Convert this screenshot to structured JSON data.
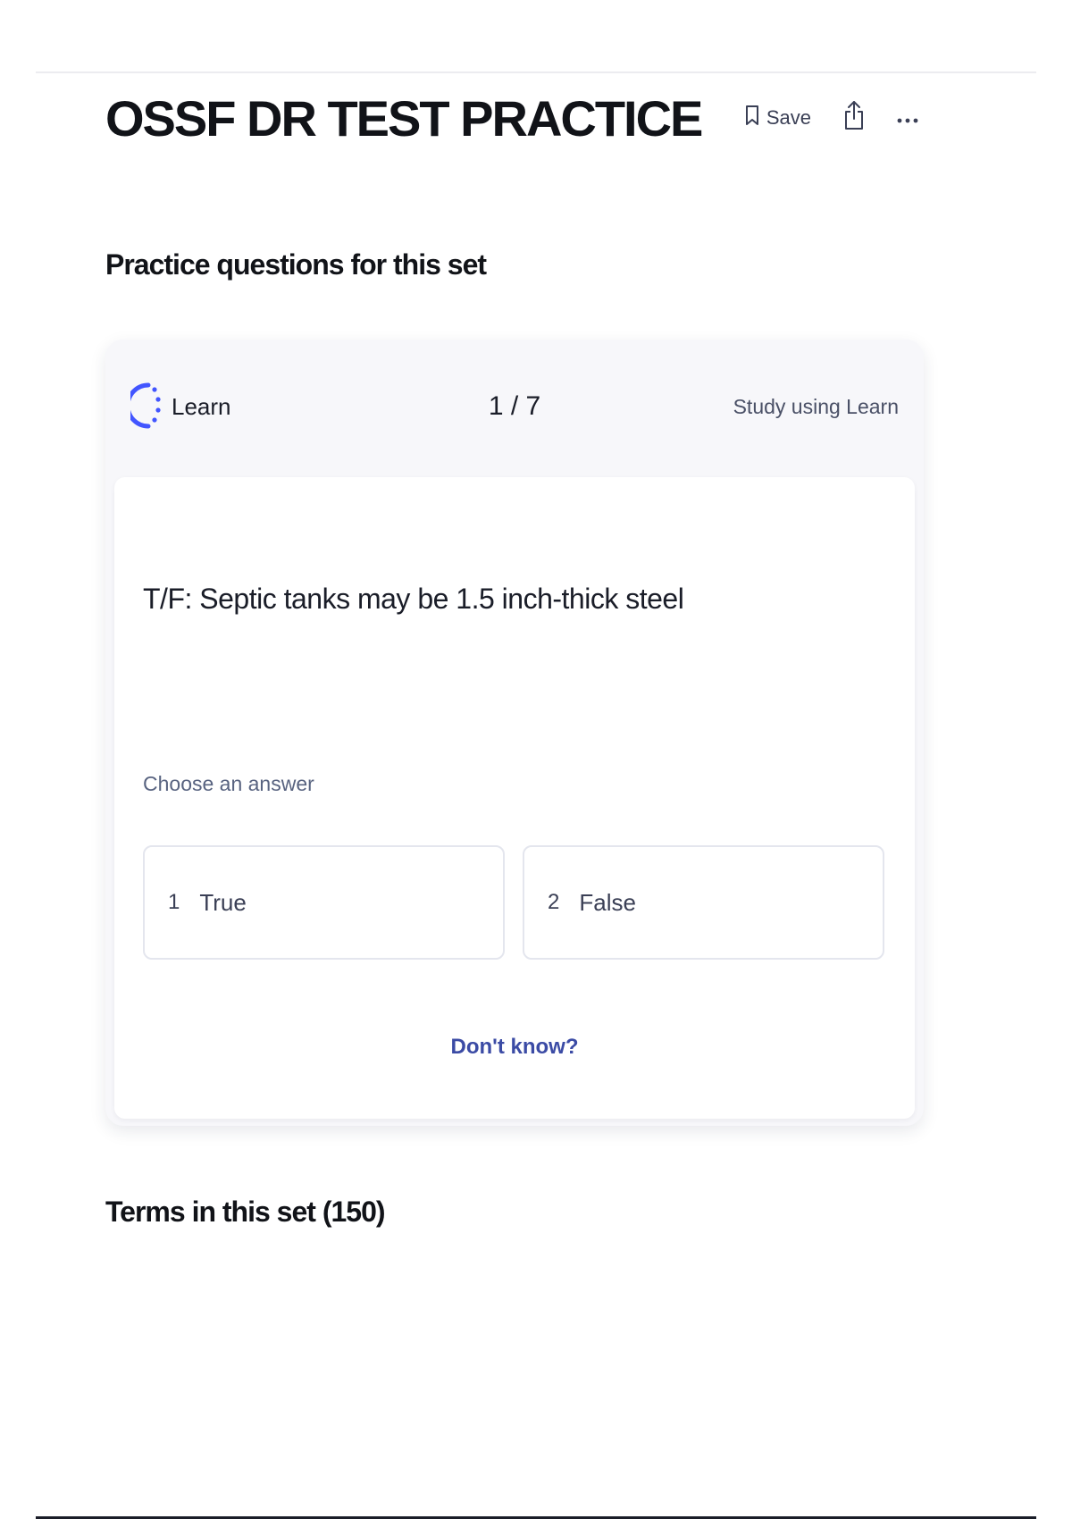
{
  "header": {
    "title": "OSSF DR TEST PRACTICE",
    "save_label": "Save",
    "icons": [
      "bookmark-icon",
      "share-icon",
      "more-icon"
    ]
  },
  "practice": {
    "heading": "Practice questions for this set",
    "mode_label": "Learn",
    "progress": "1 / 7",
    "study_link": "Study using Learn",
    "question": "T/F: Septic tanks may be 1.5 inch-thick steel",
    "choose_label": "Choose an answer",
    "options": [
      {
        "number": "1",
        "label": "True"
      },
      {
        "number": "2",
        "label": "False"
      }
    ],
    "dont_know": "Don't know?"
  },
  "terms": {
    "heading": "Terms in this set (150)"
  },
  "colors": {
    "accent": "#3b4ba5",
    "learn_icon": "#4255ff"
  }
}
